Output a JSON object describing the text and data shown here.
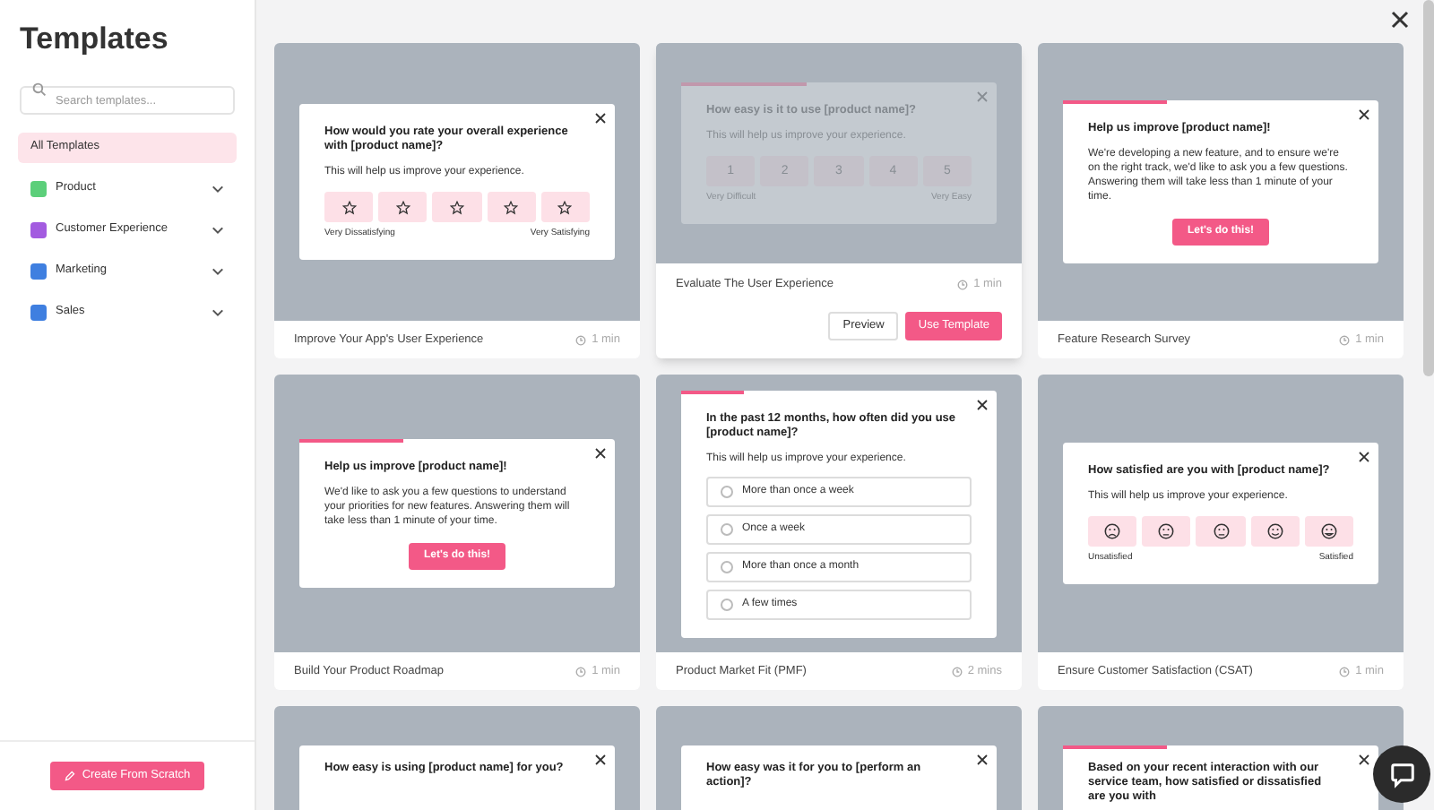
{
  "sidebar": {
    "title": "Templates",
    "search": {
      "placeholder": "Search templates..."
    },
    "items": [
      {
        "label": "All Templates",
        "selected": true
      },
      {
        "label": "Product",
        "selected": false,
        "color": "#5ccf7a",
        "expanded": false
      },
      {
        "label": "Customer Experience",
        "selected": false,
        "color": "#a35be0",
        "expanded": false
      },
      {
        "label": "Marketing",
        "selected": false,
        "color": "#3f7fe0",
        "expanded": false
      },
      {
        "label": "Sales",
        "selected": false,
        "color": "#3f7fe0",
        "expanded": false
      }
    ],
    "create_button": "Create From Scratch"
  },
  "templates": [
    {
      "title": "Improve Your App's User Experience",
      "duration": "1 min",
      "hovered": false,
      "popup": {
        "kind": "scale",
        "question": "How would you rate your overall experience with [product name]?",
        "text": "This will help us improve your experience.",
        "options": [
          {
            "kind": "star"
          },
          {
            "kind": "star"
          },
          {
            "kind": "star"
          },
          {
            "kind": "star"
          },
          {
            "kind": "star"
          }
        ],
        "low": "Very Dissatisfying",
        "high": "Very Satisfying"
      }
    },
    {
      "title": "Evaluate The User Experience",
      "duration": "1 min",
      "hovered": true,
      "actions": [
        "Preview",
        "Use Template"
      ],
      "popup": {
        "kind": "scale",
        "level": 0.4,
        "question": "How easy is it to use [product name]?",
        "text": "This will help us improve your experience.",
        "options": [
          {
            "kind": "number",
            "label": "1"
          },
          {
            "kind": "number",
            "label": "2"
          },
          {
            "kind": "number",
            "label": "3"
          },
          {
            "kind": "number",
            "label": "4"
          },
          {
            "kind": "number",
            "label": "5"
          }
        ],
        "low": "Very Difficult",
        "high": "Very Easy"
      }
    },
    {
      "title": "Feature Research Survey",
      "duration": "1 min",
      "hovered": false,
      "popup": {
        "kind": "intro",
        "level": 0.33,
        "question": "Help us improve [product name]!",
        "text": "We're developing a new feature, and to ensure we're on the right track, we'd like to ask you a few questions. Answering them will take less than 1 minute of your time.",
        "button": "Let's do this!"
      }
    },
    {
      "title": "Build Your Product Roadmap",
      "duration": "1 min",
      "hovered": false,
      "popup": {
        "kind": "intro",
        "level": 0.33,
        "question": "Help us improve [product name]!",
        "text": "We'd like to ask you a few questions to understand your priorities for new features. Answering them will take less than 1 minute of your time.",
        "button": "Let's do this!"
      }
    },
    {
      "title": "Product Market Fit (PMF)",
      "duration": "2 mins",
      "hovered": false,
      "popup": {
        "kind": "choice",
        "level": 0.2,
        "question": "In the past 12 months, how often did you use [product name]?",
        "text": "This will help us improve your experience.",
        "options": [
          "More than once a week",
          "Once a week",
          "More than once a month",
          "A few times"
        ]
      }
    },
    {
      "title": "Ensure Customer Satisfaction (CSAT)",
      "duration": "1 min",
      "hovered": false,
      "popup": {
        "kind": "scale",
        "question": "How satisfied are you with [product name]?",
        "text": "This will help us improve your experience.",
        "options": [
          {
            "kind": "frown"
          },
          {
            "kind": "flat"
          },
          {
            "kind": "flat"
          },
          {
            "kind": "smile"
          },
          {
            "kind": "grin"
          }
        ],
        "low": "Unsatisfied",
        "high": "Satisfied"
      }
    },
    {
      "hovered": false,
      "popup": {
        "kind": "partial",
        "question": "How easy is using [product name] for you?"
      }
    },
    {
      "hovered": false,
      "popup": {
        "kind": "partial",
        "question": "How easy was it for you to [perform an action]?"
      }
    },
    {
      "hovered": false,
      "popup": {
        "kind": "partial",
        "level": 0.33,
        "question": "Based on your recent interaction with our service team, how satisfied or dissatisfied are you with"
      }
    }
  ]
}
